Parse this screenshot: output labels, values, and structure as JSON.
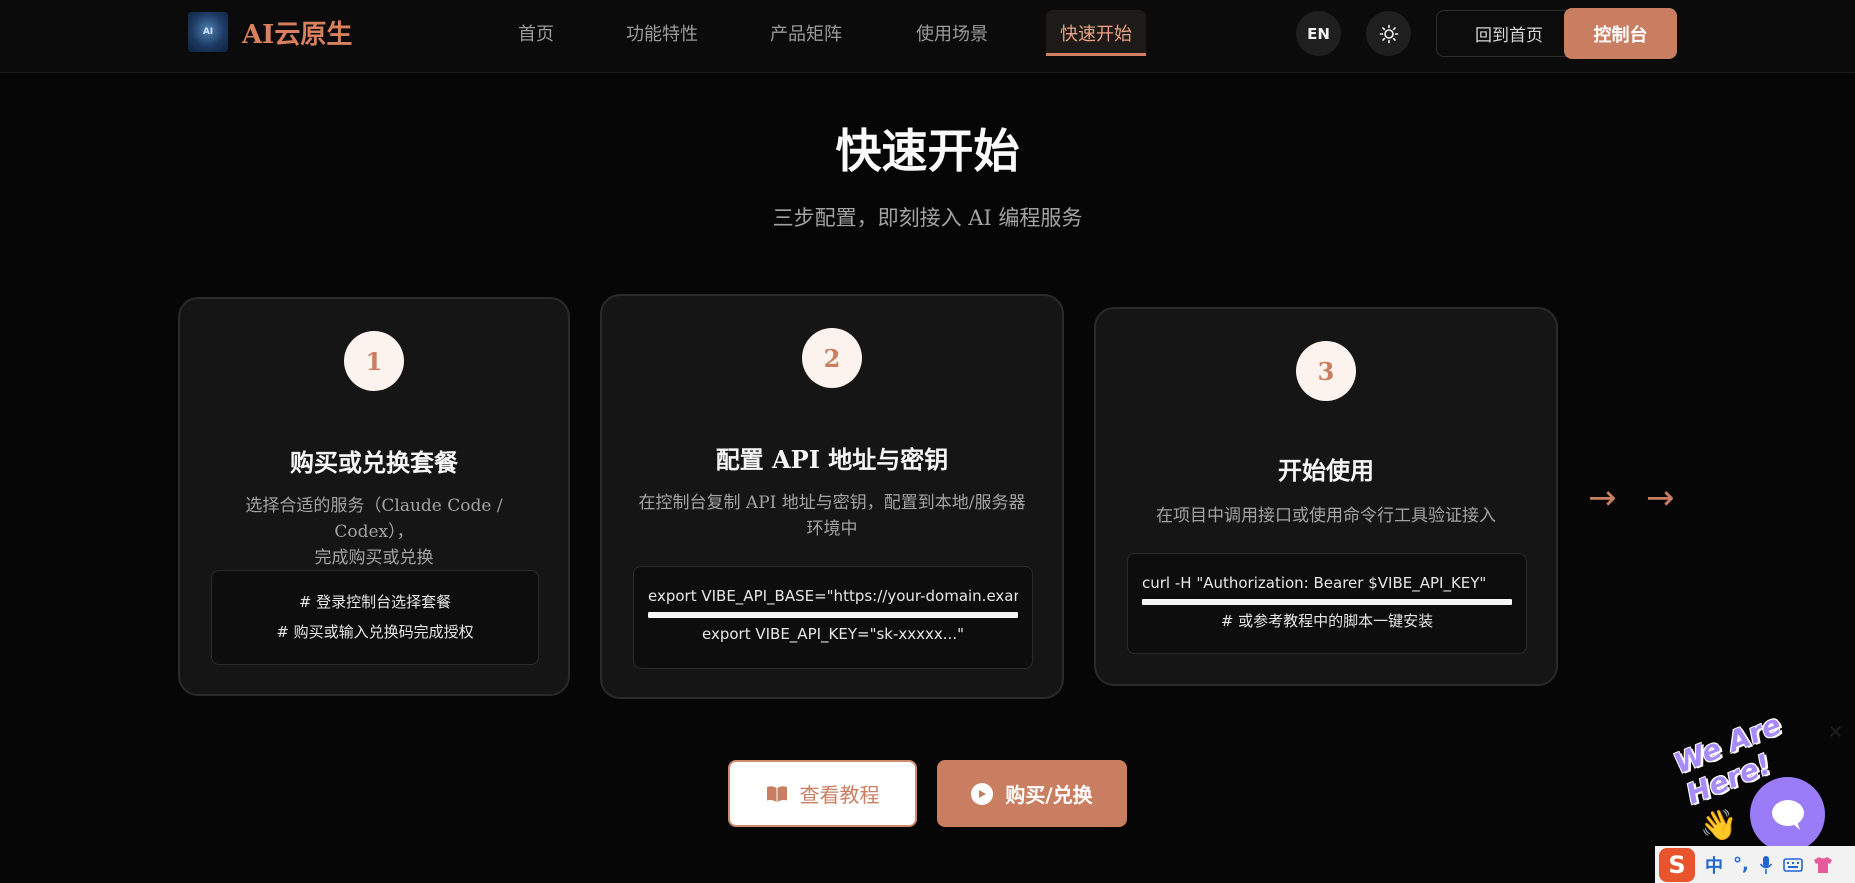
{
  "header": {
    "brand": "AI云原生",
    "logo_text": "AI",
    "nav": [
      "首页",
      "功能特性",
      "产品矩阵",
      "使用场景",
      "快速开始"
    ],
    "active_nav": "快速开始",
    "lang_label": "EN",
    "home_label": "回到首页",
    "console_label": "控制台"
  },
  "section": {
    "title": "快速开始",
    "subtitle": "三步配置，即刻接入 AI 编程服务"
  },
  "steps": [
    {
      "num": "1",
      "title": "购买或兑换套餐",
      "desc_line1": "选择合适的服务（Claude Code / Codex），",
      "desc_line2": "完成购买或兑换",
      "code": [
        "# 登录控制台选择套餐",
        "# 购买或输入兑换码完成授权"
      ]
    },
    {
      "num": "2",
      "title": "配置 API 地址与密钥",
      "desc_line1": "在控制台复制 API 地址与密钥，配置到本地/服务器",
      "desc_line2": "环境中",
      "code": [
        "export VIBE_API_BASE=\"https://your-domain.example\"",
        "export VIBE_API_KEY=\"sk-xxxxx...\""
      ]
    },
    {
      "num": "3",
      "title": "开始使用",
      "desc_line1": "在项目中调用接口或使用命令行工具验证接入",
      "desc_line2": "",
      "code": [
        "curl -H \"Authorization: Bearer $VIBE_API_KEY\"",
        "# 或参考教程中的脚本一键安装"
      ]
    }
  ],
  "buttons": {
    "tutorial": "查看教程",
    "buy": "购买/兑换"
  },
  "chat": {
    "label": "We Are Here!",
    "close": "✕"
  },
  "ime": {
    "logo": "S",
    "mode": "中",
    "punct": "°,"
  },
  "colors": {
    "accent": "#c97e62",
    "background": "#060606",
    "chat": "#9b7cf8"
  }
}
